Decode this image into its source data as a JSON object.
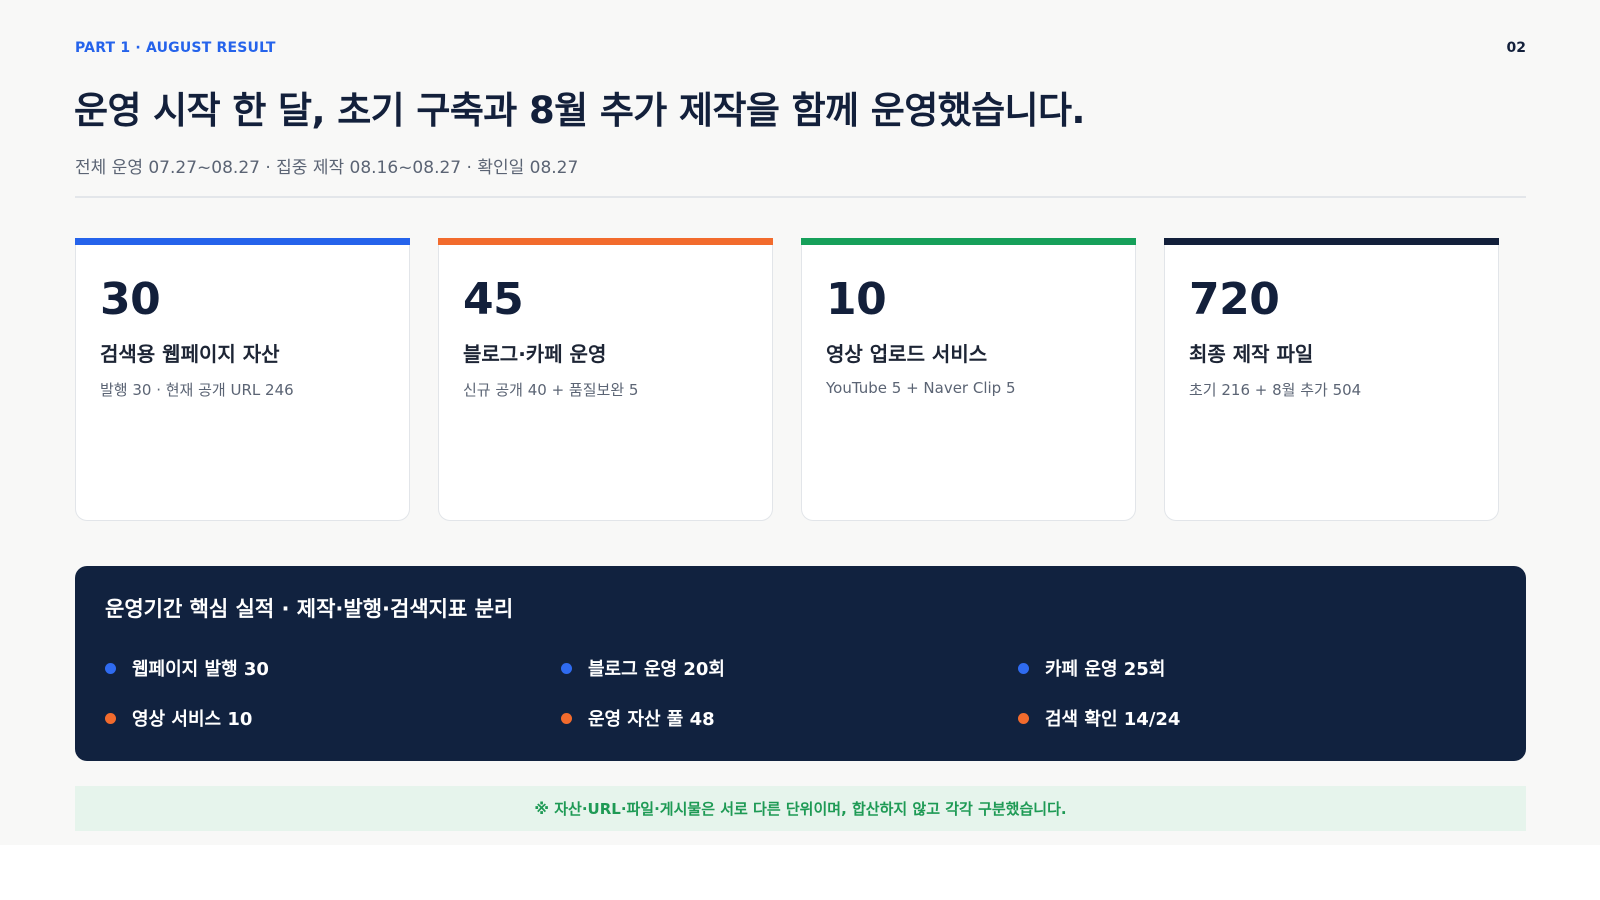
{
  "header": {
    "kicker": "PART 1 · AUGUST RESULT",
    "page_number": "02",
    "title": "운영 시작 한 달, 초기 구축과 8월 추가 제작을 함께 운영했습니다.",
    "subtitle": "전체 운영 07.27~08.27 · 집중 제작 08.16~08.27 · 확인일 08.27"
  },
  "cards": [
    {
      "value": "30",
      "label": "검색용 웹페이지 자산",
      "detail": "발행 30 · 현재 공개 URL 246",
      "accent": "#2563eb"
    },
    {
      "value": "45",
      "label": "블로그·카페 운영",
      "detail": "신규 공개 40 + 품질보완 5",
      "accent": "#f26b2d"
    },
    {
      "value": "10",
      "label": "영상 업로드 서비스",
      "detail": "YouTube 5 + Naver Clip 5",
      "accent": "#16a05a"
    },
    {
      "value": "720",
      "label": "최종 제작 파일",
      "detail": "초기 216 + 8월 추가 504",
      "accent": "#13203b"
    }
  ],
  "panel": {
    "title": "운영기간 핵심 실적 · 제작·발행·검색지표 분리",
    "metrics": [
      {
        "text": "웹페이지 발행 30",
        "color": "#2f6bf0"
      },
      {
        "text": "블로그 운영 20회",
        "color": "#2f6bf0"
      },
      {
        "text": "카페 운영 25회",
        "color": "#2f6bf0"
      },
      {
        "text": "영상 서비스 10",
        "color": "#f26b2d"
      },
      {
        "text": "운영 자산 풀 48",
        "color": "#f26b2d"
      },
      {
        "text": "검색 확인 14/24",
        "color": "#f26b2d"
      }
    ]
  },
  "note": {
    "text": "※ 자산·URL·파일·게시물은 서로 다른 단위이며, 합산하지 않고 각각 구분했습니다."
  }
}
